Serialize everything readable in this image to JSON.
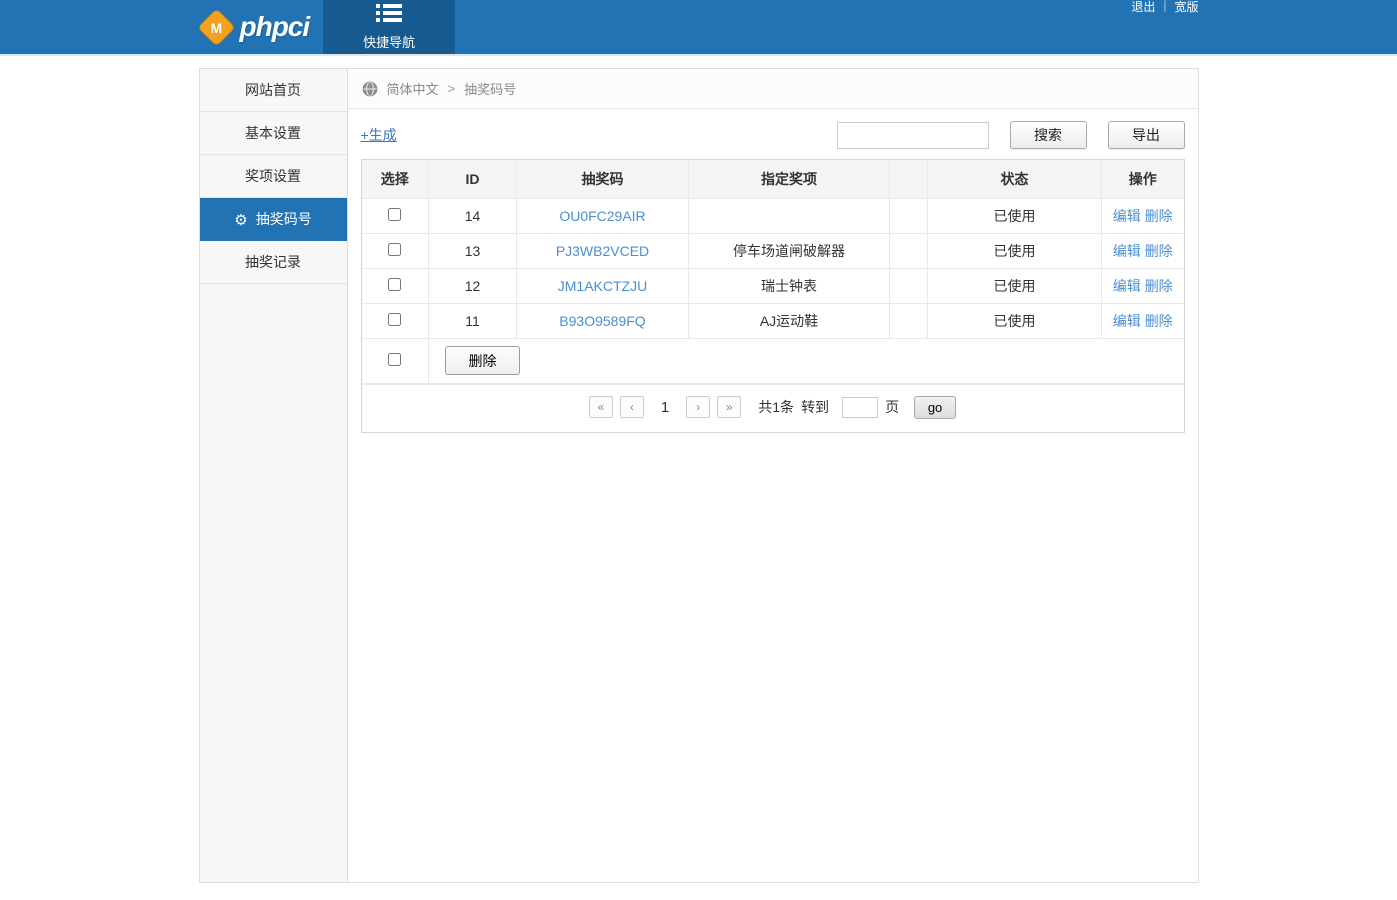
{
  "header": {
    "logo_badge": "M",
    "logo_text": "phpci",
    "quick_nav_label": "快捷导航",
    "logout_label": "退出",
    "wide_version_label": "宽版"
  },
  "sidebar": {
    "items": [
      {
        "label": "网站首页",
        "active": false
      },
      {
        "label": "基本设置",
        "active": false
      },
      {
        "label": "奖项设置",
        "active": false
      },
      {
        "label": "抽奖码号",
        "active": true
      },
      {
        "label": "抽奖记录",
        "active": false
      }
    ]
  },
  "breadcrumb": {
    "language": "简体中文",
    "separator": ">",
    "page": "抽奖码号"
  },
  "toolbar": {
    "generate_link": "+生成",
    "search_value": "",
    "search_button": "搜索",
    "export_button": "导出"
  },
  "table": {
    "headers": [
      "选择",
      "ID",
      "抽奖码",
      "指定奖项",
      "",
      "状态",
      "操作"
    ],
    "rows": [
      {
        "id": "14",
        "code": "OU0FC29AIR",
        "prize": "",
        "status": "已使用",
        "edit": "编辑",
        "delete": "删除"
      },
      {
        "id": "13",
        "code": "PJ3WB2VCED",
        "prize": "停车场道闸破解器",
        "status": "已使用",
        "edit": "编辑",
        "delete": "删除"
      },
      {
        "id": "12",
        "code": "JM1AKCTZJU",
        "prize": "瑞士钟表",
        "status": "已使用",
        "edit": "编辑",
        "delete": "删除"
      },
      {
        "id": "11",
        "code": "B93O9589FQ",
        "prize": "AJ运动鞋",
        "status": "已使用",
        "edit": "编辑",
        "delete": "删除"
      }
    ],
    "bulk_delete_button": "删除"
  },
  "pagination": {
    "first": "«",
    "prev": "‹",
    "current_page": "1",
    "next": "›",
    "last": "»",
    "total_text": "共1条",
    "goto_text": "转到",
    "page_input_value": "",
    "page_suffix": "页",
    "go_button": "go"
  },
  "colors": {
    "header_blue": "#2173b4",
    "quick_nav_blue": "#175a8f",
    "active_item_blue": "#2173b4",
    "link_blue": "#4a8fd4",
    "logo_orange": "#f5a01f"
  }
}
